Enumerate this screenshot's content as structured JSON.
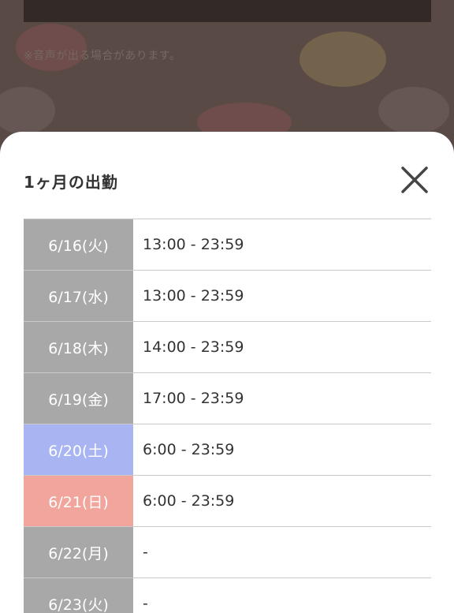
{
  "background": {
    "notice_text": "※音声が出る場合があります。"
  },
  "sheet": {
    "title": "1ヶ月の出勤",
    "close_icon": "close-icon"
  },
  "schedule": [
    {
      "date": "6/16(火)",
      "time": "13:00 - 23:59",
      "day_type": "weekday"
    },
    {
      "date": "6/17(水)",
      "time": "13:00 - 23:59",
      "day_type": "weekday"
    },
    {
      "date": "6/18(木)",
      "time": "14:00 - 23:59",
      "day_type": "weekday"
    },
    {
      "date": "6/19(金)",
      "time": "17:00 - 23:59",
      "day_type": "weekday"
    },
    {
      "date": "6/20(土)",
      "time": "6:00 - 23:59",
      "day_type": "sat"
    },
    {
      "date": "6/21(日)",
      "time": "6:00 - 23:59",
      "day_type": "sun"
    },
    {
      "date": "6/22(月)",
      "time": "-",
      "day_type": "weekday"
    },
    {
      "date": "6/23(火)",
      "time": "-",
      "day_type": "weekday"
    }
  ],
  "colors": {
    "weekday": "#a8a8a8",
    "saturday": "#a8b5f2",
    "sunday": "#f2a59c"
  }
}
